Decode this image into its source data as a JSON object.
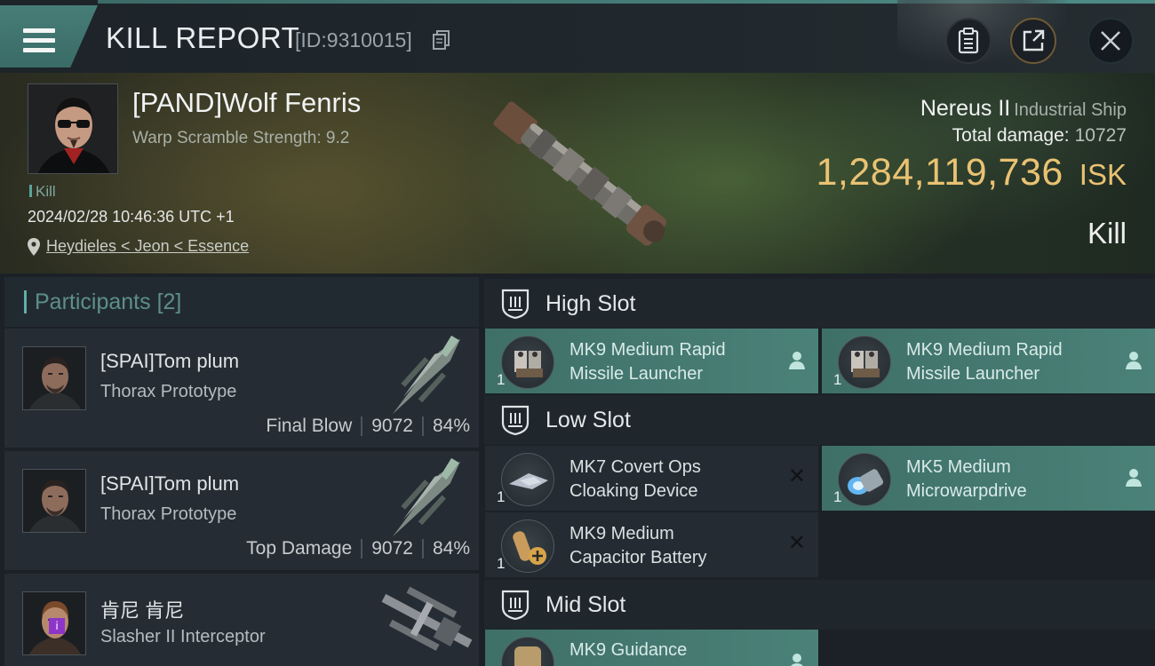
{
  "header": {
    "title": "KILL REPORT",
    "report_id": "[ID:9310015]",
    "buttons": [
      "clipboard-icon",
      "share-icon",
      "close-icon"
    ]
  },
  "victim": {
    "name": "[PAND]Wolf Fenris",
    "subtitle": "Warp Scramble Strength: 9.2",
    "tag": "Kill",
    "timestamp": "2024/02/28 10:46:36 UTC +1",
    "location": "Heydieles < Jeon < Essence",
    "ship_name": "Nereus II",
    "ship_class": "Industrial Ship",
    "total_damage_label": "Total damage:",
    "total_damage": "10727",
    "isk_value": "1,284,119,736",
    "isk_unit": "ISK",
    "result": "Kill"
  },
  "participants": {
    "label": "Participants",
    "count": "[2]",
    "rows": [
      {
        "name": "[SPAI]Tom plum",
        "ship": "Thorax Prototype",
        "role": "Final Blow",
        "damage": "9072",
        "percent": "84%"
      },
      {
        "name": "[SPAI]Tom plum",
        "ship": "Thorax Prototype",
        "role": "Top Damage",
        "damage": "9072",
        "percent": "84%"
      },
      {
        "name": "肯尼 肯尼",
        "ship": "Slasher II Interceptor",
        "badge": "i"
      }
    ]
  },
  "fitting": {
    "high_slot": {
      "label": "High Slot",
      "modules": [
        {
          "name_line1": "MK9 Medium Rapid",
          "name_line2": "Missile Launcher",
          "qty": "1",
          "status": "fitted"
        },
        {
          "name_line1": "MK9 Medium Rapid",
          "name_line2": "Missile Launcher",
          "qty": "1",
          "status": "fitted"
        }
      ]
    },
    "low_slot": {
      "label": "Low Slot",
      "modules": [
        {
          "name_line1": "MK7 Covert Ops",
          "name_line2": "Cloaking Device",
          "qty": "1",
          "status": "destroyed"
        },
        {
          "name_line1": "MK5 Medium",
          "name_line2": "Microwarpdrive",
          "qty": "1",
          "status": "fitted"
        },
        {
          "name_line1": "MK9 Medium",
          "name_line2": "Capacitor Battery",
          "qty": "1",
          "status": "destroyed"
        }
      ]
    },
    "mid_slot": {
      "label": "Mid Slot",
      "modules": [
        {
          "name_line1": "MK9 Guidance",
          "status": "fitted"
        }
      ]
    }
  },
  "colors": {
    "accent_teal": "#4a8178",
    "isk_gold": "#e9c273",
    "background": "#1b2127"
  }
}
